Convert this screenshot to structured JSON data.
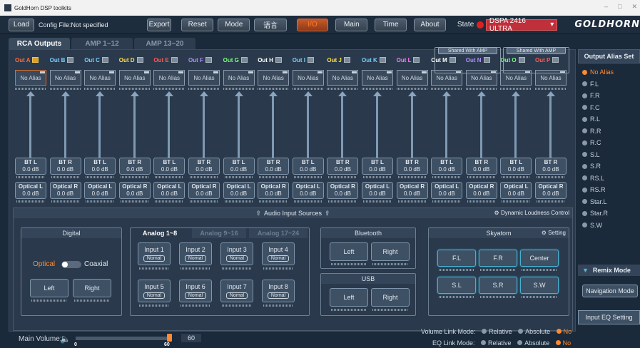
{
  "window": {
    "title": "GoldHorn DSP toolkits"
  },
  "toolbar": {
    "load": "Load",
    "config": "Config File:Not specified",
    "export": "Export",
    "reset": "Reset",
    "mode": "Mode",
    "lang": "语言",
    "tabs": [
      "I/O",
      "Main",
      "Time",
      "About"
    ],
    "state_label": "State",
    "device": "DSPA 2416 ULTRA",
    "brand": "GOLDHORN"
  },
  "main_tabs": [
    "RCA Outputs",
    "AMP 1~12",
    "AMP 13~20"
  ],
  "outputs": [
    {
      "name": "Out A",
      "color": "#ff6a3a",
      "alias": "No Alias",
      "src1": "BT L",
      "src2": "Optical L"
    },
    {
      "name": "Out B",
      "color": "#7ad0ff",
      "alias": "No Alias",
      "src1": "BT R",
      "src2": "Optical R"
    },
    {
      "name": "Out C",
      "color": "#7ad0ff",
      "alias": "No Alias",
      "src1": "BT L",
      "src2": "Optical L"
    },
    {
      "name": "Out D",
      "color": "#ffe14a",
      "alias": "No Alias",
      "src1": "BT R",
      "src2": "Optical R"
    },
    {
      "name": "Out E",
      "color": "#ff5a5a",
      "alias": "No Alias",
      "src1": "BT L",
      "src2": "Optical L"
    },
    {
      "name": "Out F",
      "color": "#b58cff",
      "alias": "No Alias",
      "src1": "BT R",
      "src2": "Optical R"
    },
    {
      "name": "Out G",
      "color": "#7aff7a",
      "alias": "No Alias",
      "src1": "BT L",
      "src2": "Optical L"
    },
    {
      "name": "Out H",
      "color": "#ffffff",
      "alias": "No Alias",
      "src1": "BT R",
      "src2": "Optical R"
    },
    {
      "name": "Out I",
      "color": "#7ad0ff",
      "alias": "No Alias",
      "src1": "BT L",
      "src2": "Optical L"
    },
    {
      "name": "Out J",
      "color": "#ffe14a",
      "alias": "No Alias",
      "src1": "BT R",
      "src2": "Optical R"
    },
    {
      "name": "Out K",
      "color": "#7ad0ff",
      "alias": "No Alias",
      "src1": "BT L",
      "src2": "Optical L"
    },
    {
      "name": "Out L",
      "color": "#ff7aff",
      "alias": "No Alias",
      "src1": "BT R",
      "src2": "Optical R"
    },
    {
      "name": "Out M",
      "color": "#ffffff",
      "alias": "No Alias",
      "src1": "BT L",
      "src2": "Optical L"
    },
    {
      "name": "Out N",
      "color": "#b58cff",
      "alias": "No Alias",
      "src1": "BT R",
      "src2": "Optical R"
    },
    {
      "name": "Out O",
      "color": "#7aff7a",
      "alias": "No Alias",
      "src1": "BT L",
      "src2": "Optical L"
    },
    {
      "name": "Out P",
      "color": "#ff5a5a",
      "alias": "No Alias",
      "src1": "BT R",
      "src2": "Optical R"
    }
  ],
  "db_value": "0.0 dB",
  "shared_label": "Shared With AMP",
  "audio_sources": {
    "title": "Audio Input Sources",
    "dlc": "Dynamic Loudness Control"
  },
  "digital": {
    "title": "Digital",
    "optical": "Optical",
    "coaxial": "Coaxial",
    "left": "Left",
    "right": "Right"
  },
  "analog": {
    "tabs": [
      "Analog 1~8",
      "Analog 9~16",
      "Analog 17~24"
    ],
    "inputs": [
      "Input 1",
      "Input 2",
      "Input 3",
      "Input 4",
      "Input 5",
      "Input 6",
      "Input 7",
      "Input 8"
    ],
    "mode": "Nomal"
  },
  "bluetooth": {
    "title": "Bluetooth",
    "left": "Left",
    "right": "Right"
  },
  "usb": {
    "title": "USB",
    "left": "Left",
    "right": "Right"
  },
  "skyatom": {
    "title": "Skyatom",
    "setting": "Setting",
    "buttons": [
      "F.L",
      "F.R",
      "Center",
      "S.L",
      "S.R",
      "S.W"
    ]
  },
  "alias_set": {
    "title": "Output Alias Set",
    "items": [
      "No Alias",
      "F.L",
      "F.R",
      "F.C",
      "R.L",
      "R.R",
      "R.C",
      "S.L",
      "S.R",
      "RS.L",
      "RS.R",
      "Star.L",
      "Star.R",
      "S.W"
    ]
  },
  "remix": {
    "title": "Remix Mode",
    "nav": "Navigation Mode",
    "eq": "Input EQ Setting"
  },
  "footer": {
    "main_volume": "Main Volume:",
    "value": "60",
    "min": "0",
    "max": "60",
    "volume_level": 1.0,
    "vol_link": "Volume Link Mode:",
    "eq_link": "EQ Link Mode:",
    "relative": "Relative",
    "absolute": "Absolute",
    "no": "No"
  }
}
